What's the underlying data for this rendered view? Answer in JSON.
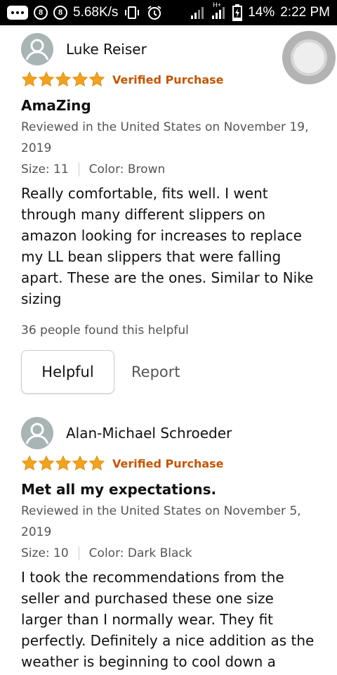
{
  "status_bar": {
    "network_speed": "5.68K/s",
    "network_type": "H+",
    "battery": "14%",
    "time": "2:22 PM",
    "badge_letter": "8"
  },
  "reviews": [
    {
      "reviewer": "Luke Reiser",
      "rating": 5,
      "verified": "Verified Purchase",
      "title": "AmaZing",
      "meta": "Reviewed in the United States on November 19, 2019",
      "size": "Size: 11",
      "color": "Color: Brown",
      "body": "Really comfortable, fits well. I went through many different slippers on amazon looking for increases to replace my LL bean slippers that were falling apart. These are the ones. Similar to Nike sizing",
      "helpful_count": "36 people found this helpful",
      "helpful_label": "Helpful",
      "report_label": "Report"
    },
    {
      "reviewer": "Alan-Michael Schroeder",
      "rating": 5,
      "verified": "Verified Purchase",
      "title": "Met all my expectations.",
      "meta": "Reviewed in the United States on November 5, 2019",
      "size": "Size: 10",
      "color": "Color: Dark Black",
      "body": "I took the recommendations from the seller and purchased these one size larger than I normally wear. They fit perfectly. Definitely a nice addition as the weather is beginning to cool down a"
    }
  ],
  "colors": {
    "star": "#f2a21c",
    "verified": "#c45500",
    "secondary_text": "#555555"
  }
}
